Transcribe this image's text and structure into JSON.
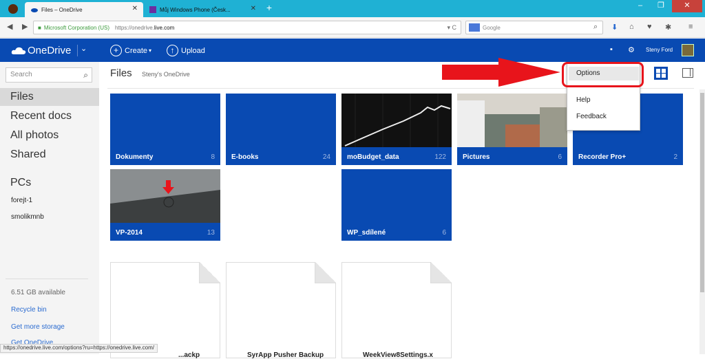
{
  "browser": {
    "tabs": [
      {
        "label": "Files – OneDrive"
      },
      {
        "label": "Můj Windows Phone (Česk..."
      }
    ],
    "new_tab": "+",
    "identity": "Microsoft Corporation (US)",
    "url_prefix": "https://onedrive.",
    "url_domain": "live.com",
    "search_placeholder": "Google",
    "status_url": "https://onedrive.live.com/options?ru=https://onedrive.live.com/"
  },
  "header": {
    "brand": "OneDrive",
    "create": "Create",
    "upload": "Upload",
    "user_name": "Steny Ford"
  },
  "sidebar": {
    "search_placeholder": "Search",
    "items": [
      "Files",
      "Recent docs",
      "All photos",
      "Shared"
    ],
    "pcs_heading": "PCs",
    "pcs": [
      "forejt-1",
      "smolikmnb"
    ],
    "storage": "6.51 GB available",
    "recycle": "Recycle bin",
    "get_storage": "Get more storage",
    "get_onedrive": "Get OneDrive"
  },
  "main": {
    "title": "Files",
    "subtitle": "Steny's OneDrive",
    "folders": [
      {
        "name": "Dokumenty",
        "count": "8"
      },
      {
        "name": "E-books",
        "count": "24"
      },
      {
        "name": "moBudget_data",
        "count": "122"
      },
      {
        "name": "Pictures",
        "count": "6"
      },
      {
        "name": "Recorder Pro+",
        "count": "2"
      },
      {
        "name": "VP-2014",
        "count": "13"
      },
      {
        "name": "WP_sdílené",
        "count": "6"
      }
    ],
    "files": [
      {
        "name": "...ackp"
      },
      {
        "name": "SyrApp Pusher Backup"
      },
      {
        "name": "WeekView8Settings.x"
      }
    ]
  },
  "menu": {
    "options": "Options",
    "help": "Help",
    "feedback": "Feedback"
  },
  "colors": {
    "brand_blue": "#094ab2",
    "tab_bar": "#1fb1d4",
    "highlight_red": "#e8141b"
  }
}
